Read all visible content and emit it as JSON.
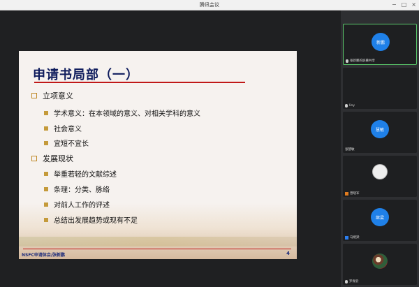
{
  "window": {
    "title": "腾讯会议"
  },
  "slide": {
    "title": "申请书局部（一）",
    "sections": [
      {
        "heading": "立项意义",
        "items": [
          "学术意义：在本领域的意义、对相关学科的意义",
          "社会意义",
          "宜短不宜长"
        ]
      },
      {
        "heading": "发展现状",
        "items": [
          "举重若轻的文献综述",
          "条理：分类、脉络",
          "对前人工作的评述",
          "总结出发展趋势或现有不足"
        ]
      }
    ],
    "footer": "NSFC申请体会/张新鹏",
    "page": "4"
  },
  "participants": [
    {
      "avatar": "新鹏",
      "label": "张新鹏的屏幕共享",
      "icon": "screen-share-icon",
      "active": true
    },
    {
      "avatar": "",
      "label": "liny",
      "icon": "mic-icon"
    },
    {
      "avatar": "慧敏",
      "label": "张慧敏",
      "icon": "none"
    },
    {
      "avatar": "",
      "label": "曾晓军",
      "icon": "user-icon"
    },
    {
      "avatar": "继梁",
      "label": "马继梁",
      "icon": "user-icon"
    },
    {
      "avatar": "",
      "label": "罗保云",
      "icon": "mic-icon"
    }
  ],
  "colors": {
    "accent": "#1f80e8",
    "title_rule": "#c01818",
    "active_border": "#5ac96b"
  }
}
